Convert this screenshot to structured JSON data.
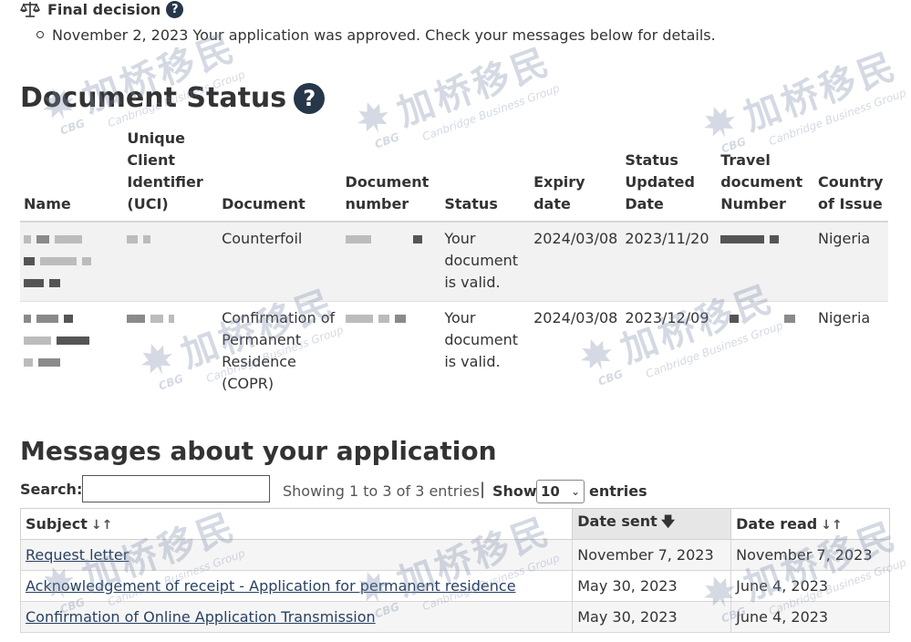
{
  "final_decision": {
    "title": "Final decision",
    "help_icon": "question-circle-icon",
    "scale_icon": "balance-scale-icon",
    "item": "November 2, 2023 Your application was approved. Check your messages below for details."
  },
  "document_status": {
    "title": "Document Status",
    "help_icon": "question-circle-icon",
    "headers": {
      "name": "Name",
      "uci": "Unique Client Identifier (UCI)",
      "document": "Document",
      "document_number": "Document number",
      "status": "Status",
      "expiry": "Expiry date",
      "updated": "Status Updated Date",
      "travel": "Travel document Number",
      "country": "Country of Issue"
    },
    "rows": [
      {
        "document": "Counterfoil",
        "status": "Your document is valid.",
        "expiry": "2024/03/08",
        "updated": "2023/11/20",
        "country": "Nigeria"
      },
      {
        "document": "Confirmation of Permanent Residence (COPR)",
        "status": "Your document is valid.",
        "expiry": "2024/03/08",
        "updated": "2023/12/09",
        "country": "Nigeria"
      }
    ]
  },
  "messages": {
    "title": "Messages about your application",
    "search_label": "Search:",
    "search_value": "",
    "showing": "Showing 1 to 3 of 3 entries",
    "separator": "|",
    "show_label": "Show",
    "show_value": "10",
    "entries_label": "entries",
    "headers": {
      "subject": "Subject",
      "date_sent": "Date sent",
      "date_read": "Date read"
    },
    "sort_icons": {
      "subject": "sort-both-icon",
      "date_sent": "sort-desc-arrow-icon",
      "date_read": "sort-both-icon"
    },
    "rows": [
      {
        "subject": "Request letter",
        "date_sent": "November 7, 2023",
        "date_read": "November 7, 2023"
      },
      {
        "subject": "Acknowledgement of receipt - Application for permanent residence",
        "date_sent": "May 30, 2023",
        "date_read": "June 4, 2023"
      },
      {
        "subject": "Confirmation of Online Application Transmission",
        "date_sent": "May 30, 2023",
        "date_read": "June 4, 2023"
      }
    ]
  },
  "watermark": {
    "cn": "加桥移民",
    "en": "Canbridge Business Group",
    "logo": "CBG"
  }
}
